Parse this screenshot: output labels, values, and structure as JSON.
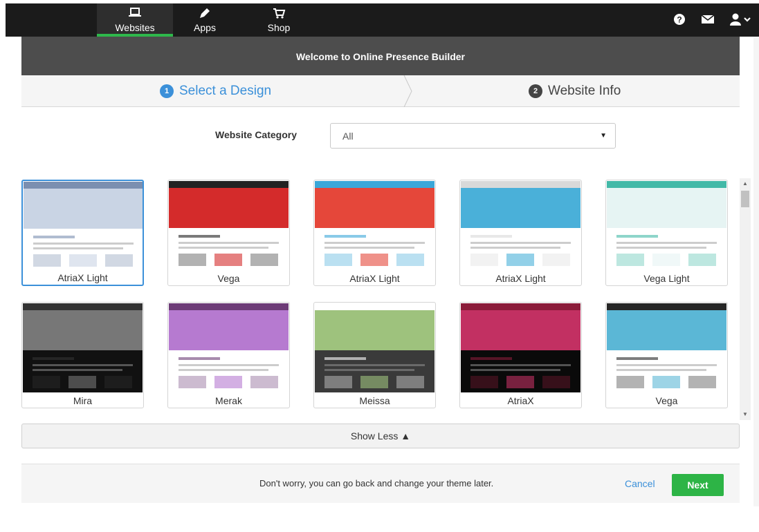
{
  "nav": {
    "tabs": [
      {
        "label": "Websites",
        "icon": "laptop-icon",
        "active": true
      },
      {
        "label": "Apps",
        "icon": "pencil-icon",
        "active": false
      },
      {
        "label": "Shop",
        "icon": "cart-icon",
        "active": false
      }
    ],
    "right_icons": [
      "help-icon",
      "mail-icon",
      "user-icon",
      "chevron-down-icon"
    ]
  },
  "banner": {
    "title": "Welcome to Online Presence Builder"
  },
  "steps": [
    {
      "number": "1",
      "label": "Select a Design",
      "active": true
    },
    {
      "number": "2",
      "label": "Website Info",
      "active": false
    }
  ],
  "category": {
    "label": "Website Category",
    "selected": "All"
  },
  "templates": [
    {
      "name": "AtriaX Light",
      "selected": true,
      "palette": [
        "#ffffff",
        "#7b8fb0",
        "#c9d4e4"
      ]
    },
    {
      "name": "Vega",
      "selected": false,
      "palette": [
        "#ffffff",
        "#222222",
        "#d42b2b"
      ]
    },
    {
      "name": "AtriaX Light",
      "selected": false,
      "palette": [
        "#ffffff",
        "#3aa7d8",
        "#e5473a"
      ]
    },
    {
      "name": "AtriaX Light",
      "selected": false,
      "palette": [
        "#ffffff",
        "#d9d9d9",
        "#4ab0d9"
      ]
    },
    {
      "name": "Vega Light",
      "selected": false,
      "palette": [
        "#ffffff",
        "#42b9a7",
        "#e6f4f3"
      ]
    },
    {
      "name": "Mira",
      "selected": false,
      "palette": [
        "#111111",
        "#333333",
        "#777777"
      ]
    },
    {
      "name": "Merak",
      "selected": false,
      "palette": [
        "#ffffff",
        "#6d3c77",
        "#b67ad0"
      ]
    },
    {
      "name": "Meissa",
      "selected": false,
      "palette": [
        "#3a3a3a",
        "#ffffff",
        "#9ec27d"
      ]
    },
    {
      "name": "AtriaX",
      "selected": false,
      "palette": [
        "#0a0a0a",
        "#8b1c3a",
        "#c23062"
      ]
    },
    {
      "name": "Vega",
      "selected": false,
      "palette": [
        "#ffffff",
        "#262626",
        "#5bb7d6"
      ]
    }
  ],
  "show_less": {
    "label": "Show Less ▲"
  },
  "footer": {
    "message": "Don't worry, you can go back and change your theme later.",
    "cancel_label": "Cancel",
    "next_label": "Next"
  },
  "colors": {
    "accent": "#3b90d9",
    "success": "#2db446",
    "dark": "#1b1b1b"
  }
}
